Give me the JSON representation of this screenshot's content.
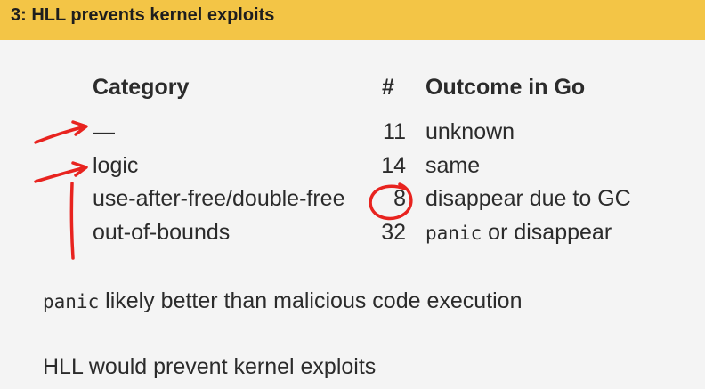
{
  "slide": {
    "title": "3: HLL prevents kernel exploits"
  },
  "table": {
    "headers": {
      "category": "Category",
      "count": "#",
      "outcome": "Outcome in Go"
    },
    "rows": [
      {
        "category": "—",
        "count": "11",
        "outcome": "unknown",
        "outcome_code": "",
        "outcome_rest": ""
      },
      {
        "category": "logic",
        "count": "14",
        "outcome": "same",
        "outcome_code": "",
        "outcome_rest": ""
      },
      {
        "category": "use-after-free/double-free",
        "count": "8",
        "outcome": "disappear due to GC",
        "outcome_code": "",
        "outcome_rest": ""
      },
      {
        "category": "out-of-bounds",
        "count": "32",
        "outcome": "",
        "outcome_code": "panic",
        "outcome_rest": " or disappear"
      }
    ]
  },
  "body": {
    "line1_code": "panic",
    "line1_rest": " likely better than malicious code execution",
    "line2": "HLL would prevent kernel exploits"
  },
  "annotations": {
    "ink_color": "#e8231f"
  }
}
